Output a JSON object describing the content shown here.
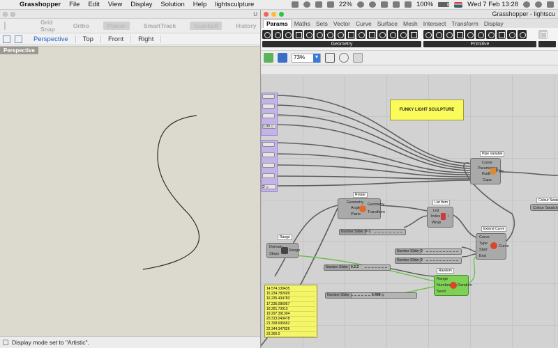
{
  "menubar": {
    "app": "Grasshopper",
    "items": [
      "File",
      "Edit",
      "View",
      "Display",
      "Solution",
      "Help",
      "lightsculpture"
    ],
    "battery_pct": "22%",
    "battery_pct2": "100%",
    "clock": "Wed 7 Feb  13:28"
  },
  "rhino": {
    "title_initial": "U",
    "toolbar": [
      "Grid Snap",
      "Ortho",
      "Planar",
      "SmartTrack",
      "Gumball",
      "History"
    ],
    "viewport_tabs": [
      "Perspective",
      "Top",
      "Front",
      "Right"
    ],
    "viewport_label": "Perspective",
    "status": "Display mode set to \"Artistic\"."
  },
  "gh": {
    "title": "Grasshopper - lightscu",
    "tabs": [
      "Params",
      "Maths",
      "Sets",
      "Vector",
      "Curve",
      "Surface",
      "Mesh",
      "Intersect",
      "Transform",
      "Display"
    ],
    "ribbon_groups": [
      "Geometry",
      "Primitive"
    ],
    "zoom": "73%",
    "title_panel": "FUNKY LIGHT SCULPTURE",
    "params": [
      "1.00 ◇",
      "2 ◇"
    ],
    "nodes": {
      "pipe": {
        "title": "Pipe Variable",
        "inputs": [
          "Curve",
          "Parameters",
          "Radii",
          "Caps"
        ],
        "output": "Pipe"
      },
      "rotate": {
        "title": "Rotate",
        "inputs": [
          "Geometry",
          "Angle",
          "Plane"
        ],
        "outputs": [
          "Geometry",
          "Transform"
        ]
      },
      "list": {
        "title": "List Item",
        "inputs": [
          "List",
          "Index",
          "Wrap"
        ],
        "output": "i"
      },
      "extend": {
        "title": "Extend Curve",
        "inputs": [
          "Curve",
          "Type",
          "Start",
          "End"
        ],
        "output": "Curve"
      },
      "range": {
        "title": "Range",
        "inputs": [
          "Domain",
          "Steps"
        ],
        "output": "Range"
      },
      "random": {
        "title": "Random",
        "inputs": [
          "Range",
          "Number",
          "Seed"
        ],
        "output": "Random"
      },
      "colour": {
        "title": "Colour Swatch",
        "label": "Colour Swatch"
      }
    },
    "sliders": [
      {
        "label": "Number Slider",
        "value": "0~1"
      },
      {
        "label": "Number Slider",
        "value": "0"
      },
      {
        "label": "Number Slider",
        "value": "0"
      },
      {
        "label": "Number Slider",
        "value": "0.3.2"
      },
      {
        "label": "Number Slider",
        "value": "5.498 ◇"
      }
    ],
    "list_values": [
      "14.574.130435",
      "15.234.782609",
      "16.235.434783",
      "17.236.086957",
      "18.281.73913",
      "19.297.391304",
      "20.313.043478",
      "21.328.695652",
      "22.344.347826",
      "23.360.0"
    ]
  }
}
